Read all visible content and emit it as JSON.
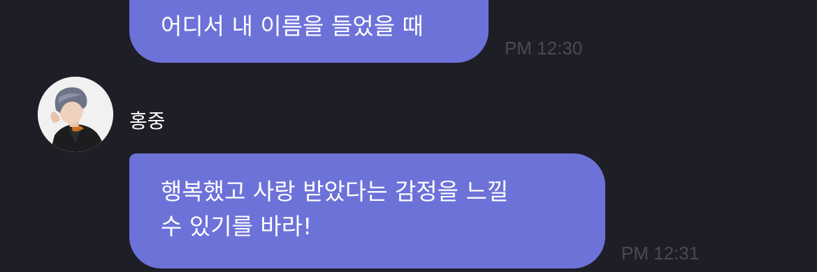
{
  "messages": [
    {
      "text": "어디서 내 이름을 들었을 때",
      "time": "PM 12:30"
    },
    {
      "sender": "홍중",
      "text": "행복했고 사랑 받았다는 감정을 느낄\n수 있기를 바라!",
      "time": "PM 12:31"
    }
  ],
  "colors": {
    "background": "#1e1e26",
    "bubble": "#6d72d8",
    "timestamp": "#4a4a55"
  }
}
